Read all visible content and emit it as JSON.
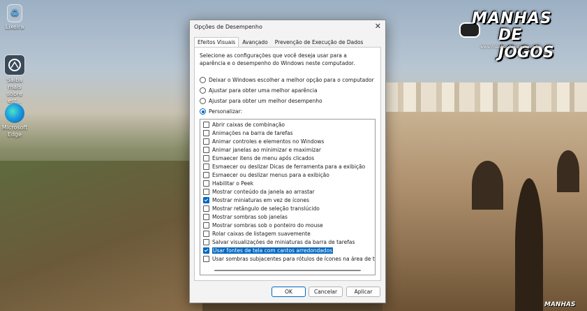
{
  "desktop": {
    "icons": [
      {
        "label": "Lixeira",
        "icon": "recycle-bin-icon"
      },
      {
        "label": "Saiba mais sobre est...",
        "icon": "learn-more-icon"
      },
      {
        "label": "Microsoft Edge",
        "icon": "edge-icon"
      }
    ]
  },
  "logo": {
    "line1": "MANHAS",
    "line2": "DE JOGOS",
    "sub": "www.manhasdejogos.com.br"
  },
  "watermark": "MANHAS",
  "dialog": {
    "title": "Opções de Desempenho",
    "close": "✕",
    "tabs": [
      "Efeitos Visuais",
      "Avançado",
      "Prevenção de Execução de Dados"
    ],
    "description": "Selecione as configurações que você deseja usar para a aparência e o desempenho do Windows neste computador.",
    "radios": [
      {
        "label": "Deixar o Windows escolher a melhor opção para o computador",
        "checked": false
      },
      {
        "label": "Ajustar para obter uma melhor aparência",
        "checked": false
      },
      {
        "label": "Ajustar para obter um melhor desempenho",
        "checked": false
      },
      {
        "label": "Personalizar:",
        "checked": true
      }
    ],
    "options": [
      {
        "label": "Abrir caixas de combinação",
        "checked": false
      },
      {
        "label": "Animações na barra de tarefas",
        "checked": false
      },
      {
        "label": "Animar controles e elementos no Windows",
        "checked": false
      },
      {
        "label": "Animar janelas ao minimizar e maximizar",
        "checked": false
      },
      {
        "label": "Esmaecer itens de menu após clicados",
        "checked": false
      },
      {
        "label": "Esmaecer ou deslizar Dicas de ferramenta para a exibição",
        "checked": false
      },
      {
        "label": "Esmaecer ou deslizar menus para a exibição",
        "checked": false
      },
      {
        "label": "Habilitar o Peek",
        "checked": false
      },
      {
        "label": "Mostrar conteúdo da janela ao arrastar",
        "checked": false
      },
      {
        "label": "Mostrar miniaturas em vez de ícones",
        "checked": true
      },
      {
        "label": "Mostrar retângulo de seleção translúcido",
        "checked": false
      },
      {
        "label": "Mostrar sombras sob janelas",
        "checked": false
      },
      {
        "label": "Mostrar sombras sob o ponteiro do mouse",
        "checked": false
      },
      {
        "label": "Rolar caixas de listagem suavemente",
        "checked": false
      },
      {
        "label": "Salvar visualizações de miniaturas da barra de tarefas",
        "checked": false
      },
      {
        "label": "Usar fontes de tela com cantos arredondados",
        "checked": true,
        "selected": true
      },
      {
        "label": "Usar sombras subjacentes para rótulos de ícones na área de trabalh",
        "checked": false
      }
    ],
    "buttons": {
      "ok": "OK",
      "cancel": "Cancelar",
      "apply": "Aplicar"
    }
  },
  "colors": {
    "accent": "#0067c0"
  }
}
